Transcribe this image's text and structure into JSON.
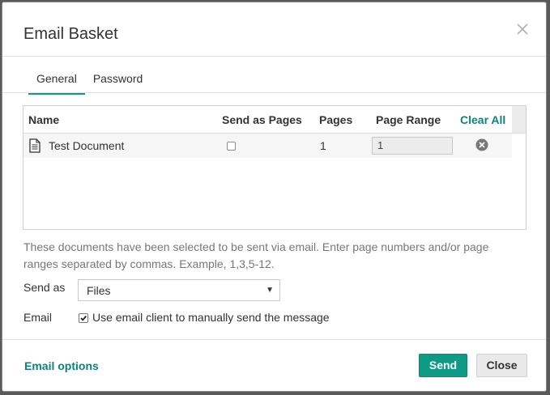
{
  "dialog": {
    "title": "Email Basket",
    "close_icon": "close-icon"
  },
  "tabs": [
    {
      "label": "General",
      "active": true
    },
    {
      "label": "Password",
      "active": false
    }
  ],
  "table": {
    "columns": {
      "name": "Name",
      "send_as_pages": "Send as Pages",
      "pages": "Pages",
      "page_range": "Page Range",
      "clear_all": "Clear All"
    },
    "rows": [
      {
        "icon": "document-icon",
        "name": "Test Document",
        "send_as_pages": false,
        "pages": "1",
        "page_range": "1",
        "remove_icon": "remove-circle-icon"
      }
    ]
  },
  "help_text": "These documents have been selected to be sent via email. Enter page numbers and/or page ranges separated by commas. Example, 1,3,5-12.",
  "send_as": {
    "label": "Send as",
    "value": "Files"
  },
  "email": {
    "label": "Email",
    "checkbox_label": "Use email client to manually send the message",
    "checked": true
  },
  "footer": {
    "email_options": "Email options",
    "send_label": "Send",
    "close_label": "Close"
  },
  "colors": {
    "accent": "#0e9b85",
    "link": "#12807a"
  }
}
